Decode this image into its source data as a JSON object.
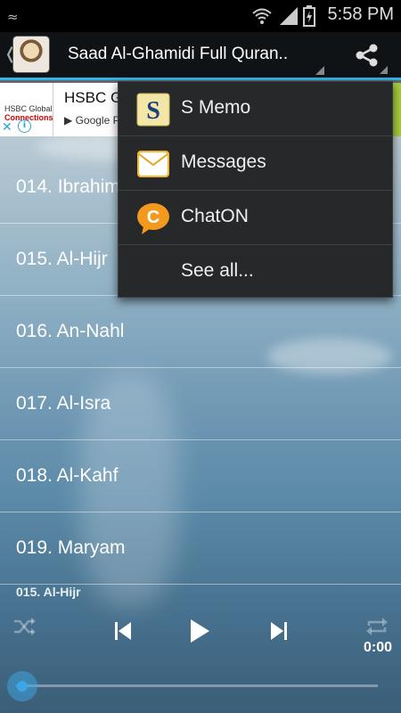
{
  "status_bar": {
    "time": "5:58 PM",
    "notification_glyph": "≈"
  },
  "action_bar": {
    "back_glyph": "❬",
    "title": "Saad Al-Ghamidi Full Quran.."
  },
  "ad": {
    "logo_line1": "HSBC Global",
    "logo_line2": "Connections",
    "title": "HSBC G",
    "store": "▶ Google P",
    "close_glyph": "✕",
    "info_glyph": "i"
  },
  "tracks": [
    {
      "label": "014. Ibrahim"
    },
    {
      "label": "015. Al-Hijr"
    },
    {
      "label": "016. An-Nahl"
    },
    {
      "label": "017. Al-Isra"
    },
    {
      "label": "018. Al-Kahf"
    },
    {
      "label": "019. Maryam"
    }
  ],
  "share_menu": {
    "items": [
      {
        "label": "S Memo",
        "icon": "s-memo-icon"
      },
      {
        "label": "Messages",
        "icon": "messages-icon"
      },
      {
        "label": "ChatON",
        "icon": "chaton-icon"
      },
      {
        "label": "See all...",
        "icon": ""
      }
    ]
  },
  "player": {
    "now_playing": "015. Al-Hijr",
    "time": "0:00",
    "progress": 0
  },
  "colors": {
    "accent": "#32b4e6",
    "seek": "#3ea6e6",
    "ad_green": "#a7cc3c"
  }
}
